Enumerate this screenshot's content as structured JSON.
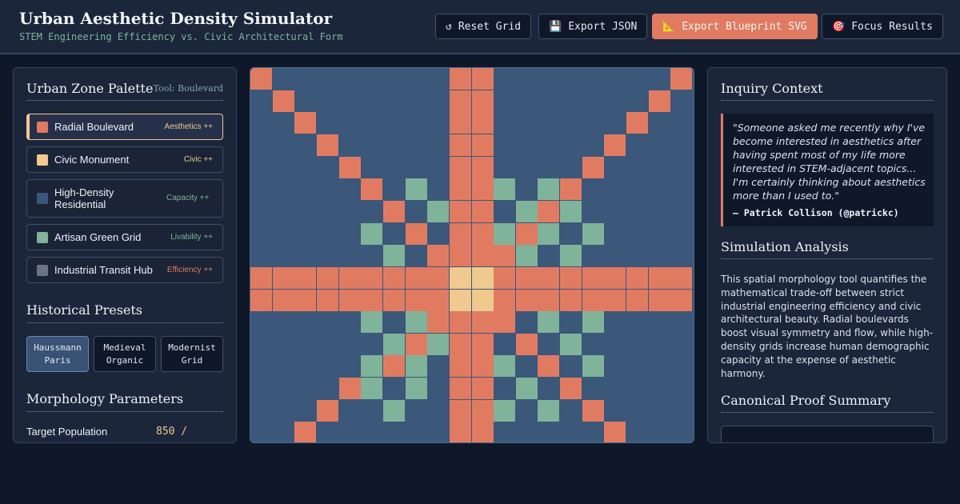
{
  "header": {
    "title": "Urban Aesthetic Density Simulator",
    "subtitle": "STEM Engineering Efficiency vs. Civic Architectural Form",
    "buttons": [
      {
        "label": "Reset Grid",
        "icon": "↺",
        "icon_name": "reset-icon"
      },
      {
        "label": "Export JSON",
        "icon": "💾",
        "icon_name": "save-icon"
      },
      {
        "label": "Export Blueprint SVG",
        "icon": "📐",
        "icon_name": "ruler-icon"
      },
      {
        "label": "Focus Results",
        "icon": "🎯",
        "icon_name": "target-icon"
      }
    ]
  },
  "palette": {
    "title": "Urban Zone Palette",
    "tool_label": "Tool: Boulevard",
    "zones": [
      {
        "name": "Radial Boulevard",
        "tag": "Aesthetics ++",
        "color": "#e07b62",
        "tag_color": "#f0c98f",
        "active": true
      },
      {
        "name": "Civic Monument",
        "tag": "Civic ++",
        "color": "#f0c98f",
        "tag_color": "#f0c98f",
        "active": false
      },
      {
        "name": "High-Density Residential",
        "tag": "Capacity ++",
        "color": "#3b5779",
        "tag_color": "#7fb39a",
        "active": false
      },
      {
        "name": "Artisan Green Grid",
        "tag": "Livability ++",
        "color": "#7fb39a",
        "tag_color": "#7fb39a",
        "active": false
      },
      {
        "name": "Industrial Transit Hub",
        "tag": "Efficiency ++",
        "color": "#6b7482",
        "tag_color": "#e07b62",
        "active": false
      }
    ]
  },
  "presets": {
    "title": "Historical Presets",
    "items": [
      {
        "label": "Haussmann Paris",
        "active": true
      },
      {
        "label": "Medieval Organic",
        "active": false
      },
      {
        "label": "Modernist Grid",
        "active": false
      }
    ]
  },
  "parameters": {
    "title": "Morphology Parameters",
    "population_label": "Target Population",
    "population_value": "850 /"
  },
  "context": {
    "title": "Inquiry Context",
    "quote": "\"Someone asked me recently why I've become interested in aesthetics after having spent most of my life more interested in STEM-adjacent topics... I'm certainly thinking about aesthetics more than I used to.\"",
    "author": "— Patrick Collison (@patrickc)"
  },
  "analysis": {
    "title": "Simulation Analysis",
    "text": "This spatial morphology tool quantifies the mathematical trade-off between strict industrial engineering efficiency and civic architectural beauty. Radial boulevards boost visual symmetry and flow, while high-density grids increase human demographic capacity at the expense of aesthetic harmony."
  },
  "proof": {
    "title": "Canonical Proof Summary"
  },
  "colors": {
    "boulevard": "#e07b62",
    "monument": "#f0c98f",
    "residential": "#3b5779",
    "green": "#7fb39a"
  },
  "grid": {
    "cols": 20,
    "rows": 17,
    "legend": {
      "B": "boulevard",
      "M": "monument",
      "R": "residential",
      "G": "green"
    },
    "cells": [
      "BRRRRRRRRBBRRRRRRRRB",
      "RBRRRRRRRBBRRRRRRRBR",
      "RRBRRRRRRBBRRRRRRBRR",
      "RRRBRRRRRBBRRRRRBRRR",
      "RRRRBRRRRBBRRRRBRRRR",
      "RRRRRBRGRBBGRGBRRRRR",
      "RRRRRRBRGBBRGBGRRRRR",
      "RRRRRGRBRBBGBGRGRRRR",
      "RRRRRRGRBBBBGRGRRRRR",
      "BBBBBBBBBMMBBBBBBBBB",
      "BBBBBBBBBMMBBBBBBBBB",
      "RRRRRGRGBBBBRGRGRRRR",
      "RRRRRRGBGBBRBRGRRRRR",
      "RRRRRGBGRBBGRBRGRRRR",
      "RRRRBGRGRBBRGRBRRRRR",
      "RRRBRRGRRBBGRGRBRRRR",
      "RRBRRRRRRBBRRRRRBRRR"
    ]
  }
}
